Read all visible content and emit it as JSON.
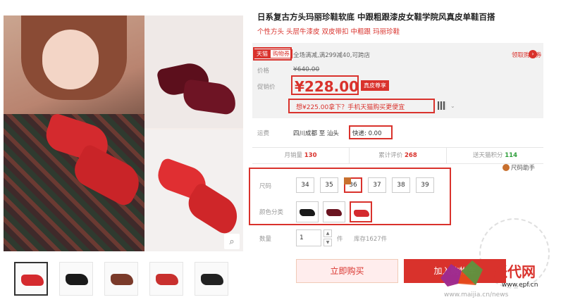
{
  "title": "日系复古方头玛丽珍鞋软底 中跟粗跟漆皮女鞋学院风真皮单鞋百搭",
  "subtitle": "个性方头 头层牛漆皮 双皮带扣 中粗跟 玛丽珍鞋",
  "promo": {
    "tag_tmall": "天猫",
    "tag_coupon": "购物券",
    "text": "全场满减,满299减40,可跨店",
    "coupon_link": "领取购物券",
    "arrow": "›"
  },
  "price": {
    "label": "价格",
    "original": "¥640.00",
    "promo_label": "促销价",
    "promo_value": "¥228.00",
    "badge": "真皮尊享",
    "app_offer": "想¥225.00拿下？手机天猫购买更便宜",
    "qr_chevron": "⌄"
  },
  "shipping": {
    "label": "运费",
    "from_to": "四川成都 至 汕头",
    "fee": "快递: 0.00"
  },
  "stats": [
    {
      "label": "月销量",
      "value": "130",
      "green": false
    },
    {
      "label": "累计评价",
      "value": "268",
      "green": false
    },
    {
      "label": "送天猫积分",
      "value": "114",
      "green": true
    }
  ],
  "size_helper": "尺码助手",
  "size": {
    "label": "尺码",
    "options": [
      "34",
      "35",
      "36",
      "37",
      "38",
      "39"
    ],
    "selected": "36"
  },
  "color": {
    "label": "颜色分类",
    "swatches": [
      {
        "name": "黑色",
        "color": "#1a1a1a"
      },
      {
        "name": "酒红色",
        "color": "#6a1420"
      },
      {
        "name": "红色",
        "color": "#d42a2e"
      }
    ],
    "selected_index": 2
  },
  "quantity": {
    "label": "数量",
    "value": "1",
    "unit": "件",
    "stock": "库存1627件",
    "up": "▲",
    "down": "▼"
  },
  "buttons": {
    "buy_now": "立即购买",
    "add_cart": "加入购物车"
  },
  "thumbnails": [
    {
      "color": "#d42a2e",
      "active": true
    },
    {
      "color": "#1a1a1a",
      "active": false
    },
    {
      "color": "#7a3a2a",
      "active": false
    },
    {
      "color": "#c8302e",
      "active": false
    },
    {
      "color": "#222222",
      "active": false
    }
  ],
  "zoom_icon": "⌕",
  "watermark": {
    "brand": "派代网",
    "url": "www.epf.cn",
    "bottom": "www.maijia.cn/news"
  },
  "colors": {
    "accent": "#d9322c",
    "panel_bg": "#f2f2f2",
    "green": "#2e9e3a"
  }
}
